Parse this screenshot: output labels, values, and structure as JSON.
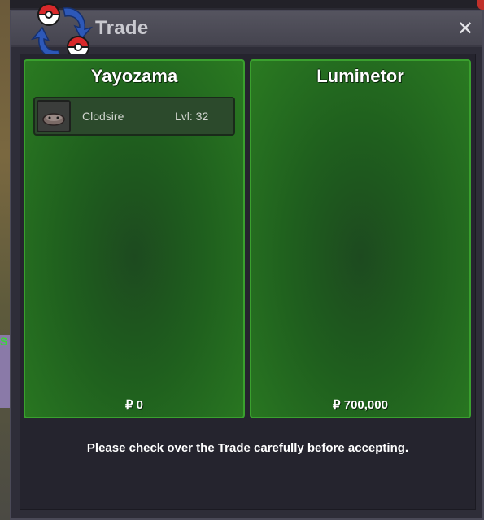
{
  "window": {
    "title": "Trade",
    "close_icon": "close-icon",
    "logo_icon": "trade-swap-icon"
  },
  "left_panel": {
    "player": "Yayozama",
    "money": "₽ 0",
    "items": [
      {
        "name": "Clodsire",
        "level": "Lvl: 32",
        "icon": "clodsire-sprite-icon"
      }
    ]
  },
  "right_panel": {
    "player": "Luminetor",
    "money": "₽ 700,000",
    "items": []
  },
  "notice": "Please check over the Trade carefully before accepting.",
  "world": {
    "side_letter": "S"
  },
  "colors": {
    "panel_green": "#2a7a21",
    "panel_border": "#3aa02e",
    "window_bg": "#2e2d38"
  }
}
